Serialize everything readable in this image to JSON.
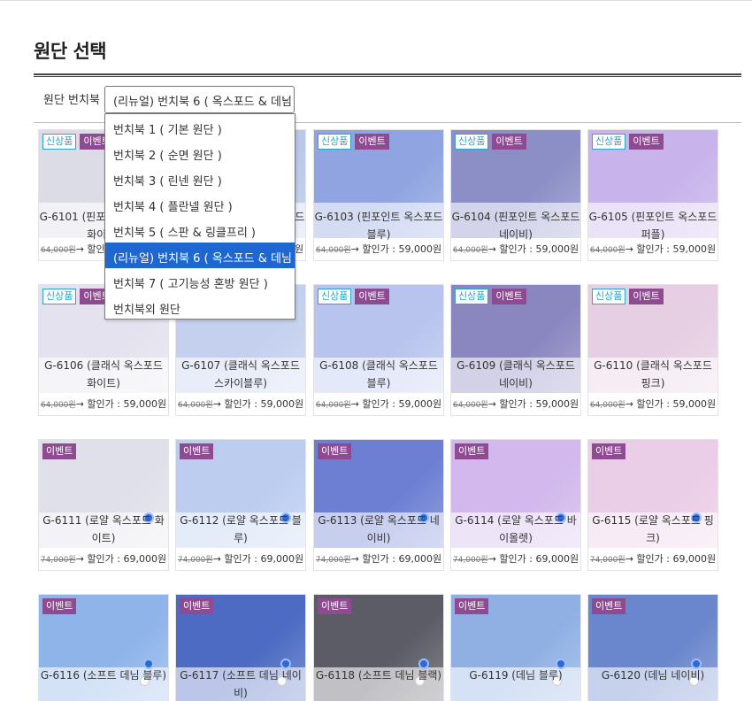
{
  "page": {
    "title": "원단 선택"
  },
  "selector": {
    "label": "원단 번치북 :",
    "value": "(리뉴얼) 번치북 6 ( 옥스포드 & 데님 )",
    "options": [
      "번치북 1 ( 기본 원단 )",
      "번치북 2 ( 순면 원단 )",
      "번치북 3 ( 린넨 원단 )",
      "번치북 4 ( 플란넬 원단 )",
      "번치북 5 ( 스판 & 링클프리 )",
      "(리뉴얼) 번치북 6 ( 옥스포드 & 데님 )",
      "번치북 7 ( 고기능성 혼방 원단 )",
      "번치북외 원단"
    ],
    "selected_index": 5
  },
  "colors": {
    "badge_new": "#2aa5c9",
    "badge_event": "#8e4b92",
    "selected_option": "#1e66d0"
  },
  "badges": {
    "new": "신상품",
    "event": "이벤트"
  },
  "fabrics": [
    {
      "name": "G-6101 (핀포인트 옥스포드 화이트)",
      "orig": "64,000원",
      "sale": "→ 할인가 : 59,000원",
      "new": true,
      "event": true,
      "color": "#dcdce6"
    },
    {
      "name": "G-6102 (핀포인트 옥스포드 스카이블루)",
      "orig": "64,000원",
      "sale": "→ 할인가 : 59,000원",
      "new": true,
      "event": true,
      "color": "#b9c8e8"
    },
    {
      "name": "G-6103 (핀포인트 옥스포드 블루)",
      "orig": "64,000원",
      "sale": "→ 할인가 : 59,000원",
      "new": true,
      "event": true,
      "color": "#8fa4e0"
    },
    {
      "name": "G-6104 (핀포인트 옥스포드 네이비)",
      "orig": "64,000원",
      "sale": "→ 할인가 : 59,000원",
      "new": true,
      "event": true,
      "color": "#8c8fc6"
    },
    {
      "name": "G-6105 (핀포인트 옥스포드 퍼플)",
      "orig": "64,000원",
      "sale": "→ 할인가 : 59,000원",
      "new": true,
      "event": true,
      "color": "#c8b4ea"
    },
    {
      "name": "G-6106 (클래식 옥스포드 화이트)",
      "orig": "64,000원",
      "sale": "→ 할인가 : 59,000원",
      "new": true,
      "event": true,
      "color": "#e4e2ee"
    },
    {
      "name": "G-6107 (클래식 옥스포드 스카이블루)",
      "orig": "64,000원",
      "sale": "→ 할인가 : 59,000원",
      "new": true,
      "event": true,
      "color": "#c4d0ee"
    },
    {
      "name": "G-6108 (클래식 옥스포드 블루)",
      "orig": "64,000원",
      "sale": "→ 할인가 : 59,000원",
      "new": true,
      "event": true,
      "color": "#b8c4ee"
    },
    {
      "name": "G-6109 (클래식 옥스포드 네이비)",
      "orig": "64,000원",
      "sale": "→ 할인가 : 59,000원",
      "new": true,
      "event": true,
      "color": "#8a86c0"
    },
    {
      "name": "G-6110 (클래식 옥스포드 핑크)",
      "orig": "64,000원",
      "sale": "→ 할인가 : 59,000원",
      "new": true,
      "event": true,
      "color": "#e6cfe2"
    },
    {
      "name": "G-6111 (로얄 옥스포드 화이트)",
      "orig": "74,000원",
      "sale": "→ 할인가 : 69,000원",
      "new": false,
      "event": true,
      "color": "#e0e0ea"
    },
    {
      "name": "G-6112 (로얄 옥스포드 블루)",
      "orig": "74,000원",
      "sale": "→ 할인가 : 69,000원",
      "new": false,
      "event": true,
      "color": "#bccdf0"
    },
    {
      "name": "G-6113 (로얄 옥스포드 네이비)",
      "orig": "74,000원",
      "sale": "→ 할인가 : 69,000원",
      "new": false,
      "event": true,
      "color": "#6c7fd2"
    },
    {
      "name": "G-6114 (로얄 옥스포드 바이올렛)",
      "orig": "74,000원",
      "sale": "→ 할인가 : 69,000원",
      "new": false,
      "event": true,
      "color": "#d2b8ec"
    },
    {
      "name": "G-6115 (로얄 옥스포드 핑크)",
      "orig": "74,000원",
      "sale": "→ 할인가 : 69,000원",
      "new": false,
      "event": true,
      "color": "#eacde6"
    },
    {
      "name": "G-6116 (소프트 데님 블루)",
      "orig": "",
      "sale": "",
      "new": false,
      "event": true,
      "color": "#8fb4ea"
    },
    {
      "name": "G-6117 (소프트 데님 네이비)",
      "orig": "",
      "sale": "",
      "new": false,
      "event": true,
      "color": "#4d6bc2"
    },
    {
      "name": "G-6118 (소프트 데님 블랙)",
      "orig": "",
      "sale": "",
      "new": false,
      "event": true,
      "color": "#5c5c66"
    },
    {
      "name": "G-6119 (데님 블루)",
      "orig": "",
      "sale": "",
      "new": false,
      "event": true,
      "color": "#90b0e4"
    },
    {
      "name": "G-6120 (데님 네이비)",
      "orig": "",
      "sale": "",
      "new": false,
      "event": true,
      "color": "#6a86cc"
    }
  ]
}
